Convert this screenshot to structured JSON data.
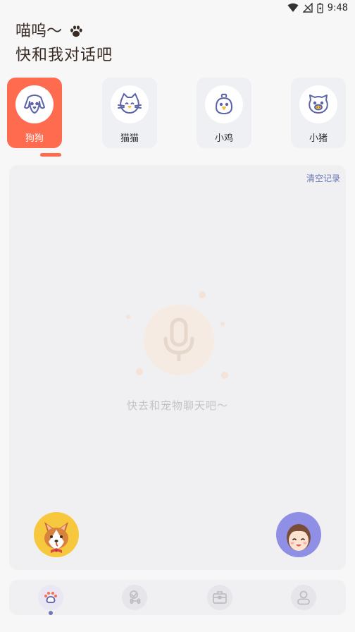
{
  "status_bar": {
    "time": "9:48"
  },
  "greeting": {
    "line1": "喵呜～",
    "line2": "快和我对话吧"
  },
  "pets": [
    {
      "label": "狗狗",
      "icon": "dog-icon",
      "active": true
    },
    {
      "label": "猫猫",
      "icon": "cat-icon",
      "active": false
    },
    {
      "label": "小鸡",
      "icon": "chick-icon",
      "active": false
    },
    {
      "label": "小猪",
      "icon": "pig-icon",
      "active": false
    }
  ],
  "chat": {
    "clear_label": "清空记录",
    "empty_text": "快去和宠物聊天吧～"
  },
  "tabs": [
    {
      "icon": "paw-icon",
      "active": true
    },
    {
      "icon": "bone-icon",
      "active": false
    },
    {
      "icon": "toolbox-icon",
      "active": false
    },
    {
      "icon": "profile-icon",
      "active": false
    }
  ],
  "colors": {
    "accent": "#ff6b4e",
    "link": "#6a78b8",
    "icon_line": "#5c64a8"
  }
}
